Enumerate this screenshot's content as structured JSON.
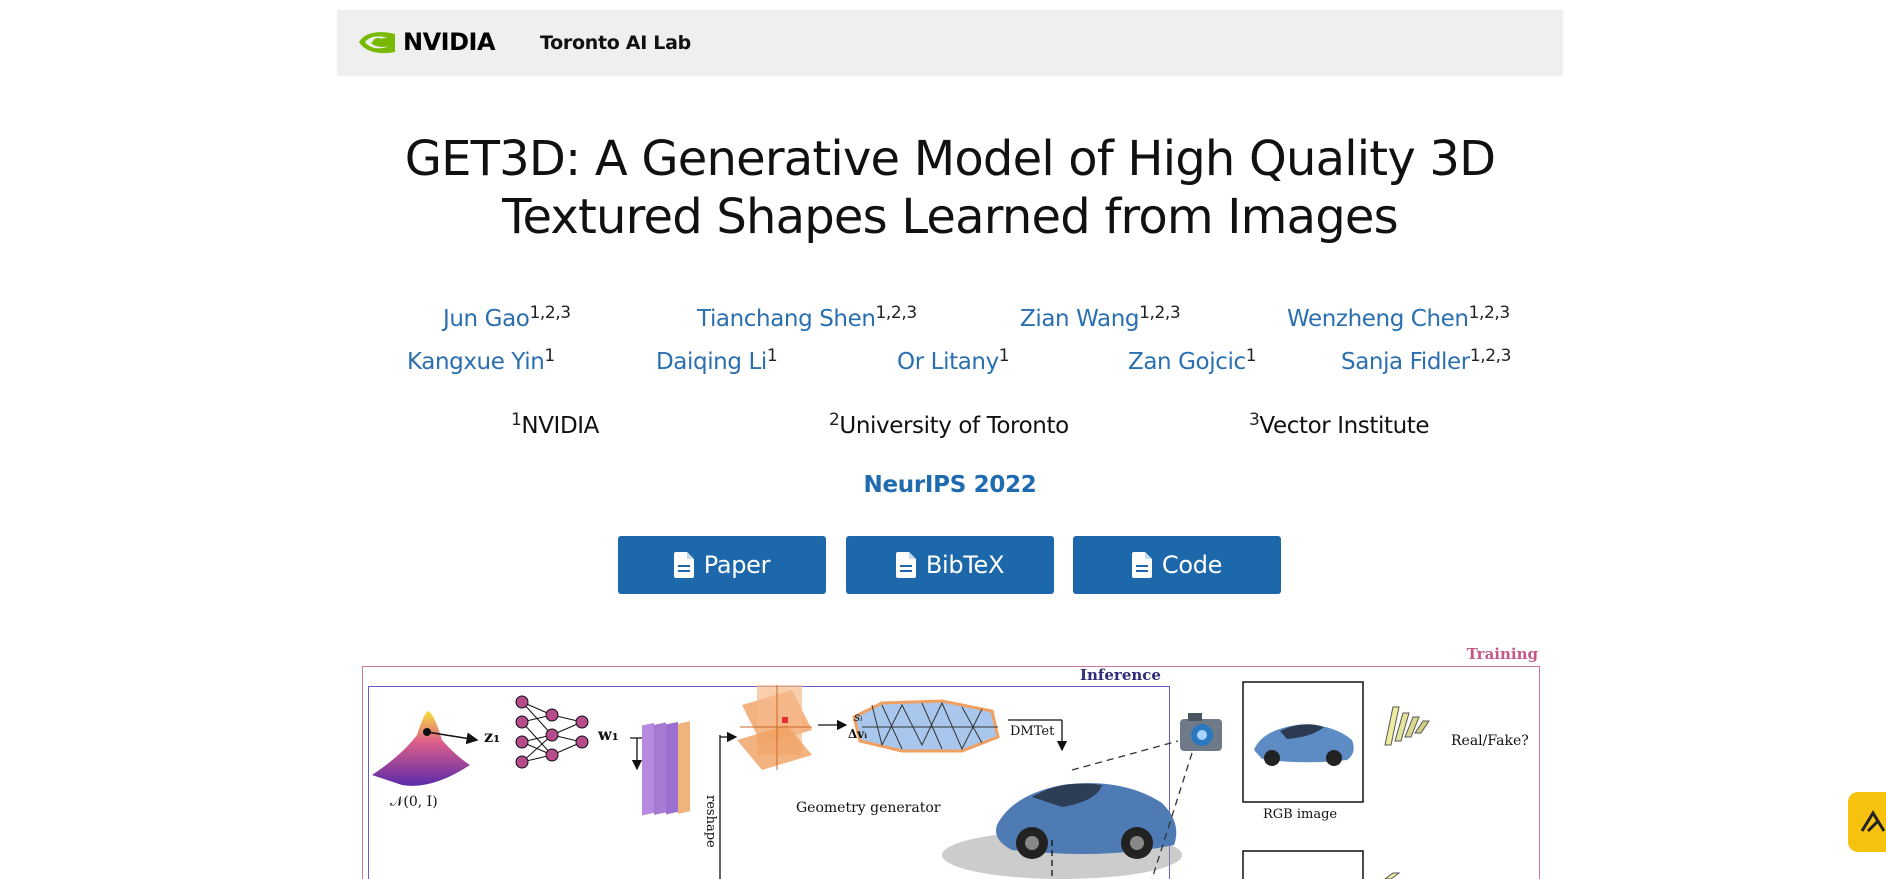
{
  "navbar": {
    "logo_text": "NVIDIA",
    "lab_name": "Toronto AI Lab"
  },
  "title": "GET3D: A Generative Model of High Quality 3D Textured Shapes Learned from Images",
  "authors": [
    {
      "name": "Jun Gao",
      "sup": "1,2,3"
    },
    {
      "name": "Tianchang Shen",
      "sup": "1,2,3"
    },
    {
      "name": "Zian Wang",
      "sup": "1,2,3"
    },
    {
      "name": "Wenzheng Chen",
      "sup": "1,2,3"
    },
    {
      "name": "Kangxue Yin",
      "sup": "1"
    },
    {
      "name": "Daiqing Li",
      "sup": "1"
    },
    {
      "name": "Or Litany",
      "sup": "1"
    },
    {
      "name": "Zan Gojcic",
      "sup": "1"
    },
    {
      "name": "Sanja Fidler",
      "sup": "1,2,3"
    }
  ],
  "affiliations": [
    {
      "sup": "1",
      "name": "NVIDIA"
    },
    {
      "sup": "2",
      "name": "University of Toronto"
    },
    {
      "sup": "3",
      "name": "Vector Institute"
    }
  ],
  "venue": "NeurIPS 2022",
  "buttons": {
    "paper": "Paper",
    "bibtex": "BibTeX",
    "code": "Code"
  },
  "figure": {
    "training_label": "Training",
    "inference_label": "Inference",
    "normal_label": "𝒩(0, I)",
    "z1_label": "z₁",
    "w1_label": "w₁",
    "reshape_label": "reshape",
    "geometry_generator_label": "Geometry generator",
    "si_label": "sᵢ",
    "dvi_label": "Δvᵢ",
    "dmtet_label": "DMTet",
    "rgb_image_label": "RGB image",
    "real_fake_label": "Real/Fake?"
  },
  "colors": {
    "link_blue": "#2a6fb0",
    "button_blue": "#1d67ab",
    "nvidia_green": "#76b900",
    "training_pink": "#d4769c",
    "inference_purple": "#6a5acd",
    "badge_yellow": "#f6c20f"
  }
}
